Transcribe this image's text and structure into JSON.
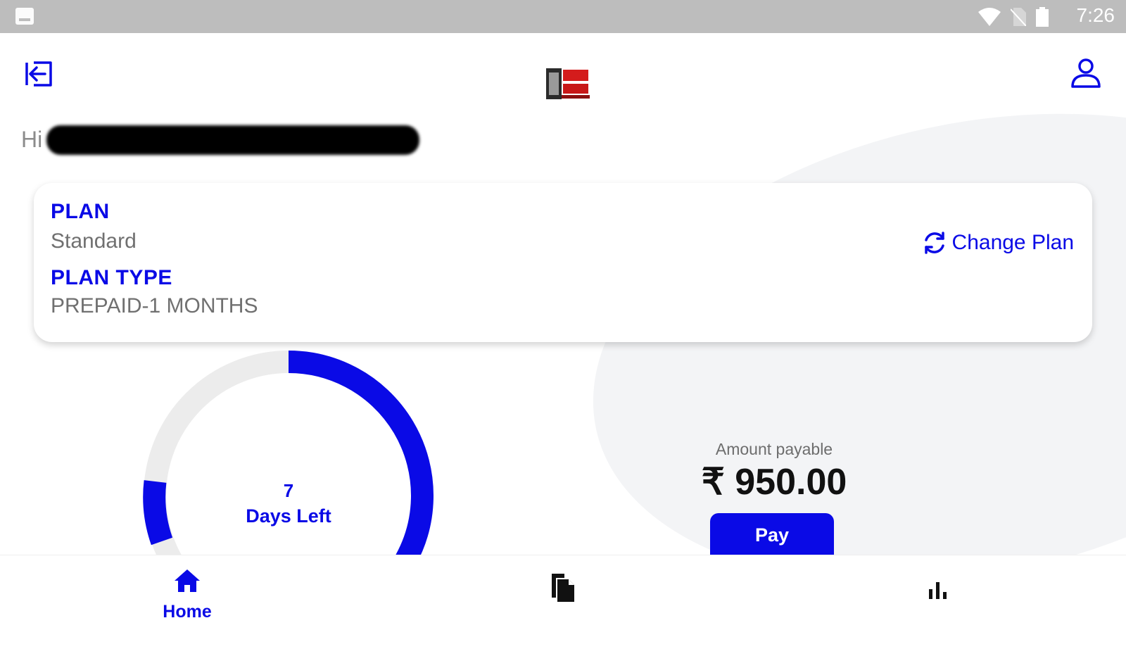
{
  "status_bar": {
    "time": "7:26"
  },
  "greeting": {
    "prefix": "Hi"
  },
  "plan_card": {
    "plan_label": "PLAN",
    "plan_value": "Standard",
    "plan_type_label": "PLAN TYPE",
    "plan_type_value": "PREPAID-1 MONTHS",
    "change_plan_label": "Change Plan"
  },
  "days_gauge": {
    "days_left": "7",
    "days_left_label": "Days Left",
    "fraction_remaining": 0.23
  },
  "payment": {
    "amount_label": "Amount payable",
    "amount": "₹ 950.00",
    "pay_label": "Pay"
  },
  "bottom_nav": {
    "items": [
      {
        "label": "Home",
        "icon": "home-icon",
        "active": true
      },
      {
        "label": "",
        "icon": "documents-icon"
      },
      {
        "label": "",
        "icon": "bar-chart-icon"
      }
    ]
  },
  "colors": {
    "accent": "#0a0ae6",
    "status_bar": "#bdbdbd",
    "gauge_track": "#ececec"
  }
}
